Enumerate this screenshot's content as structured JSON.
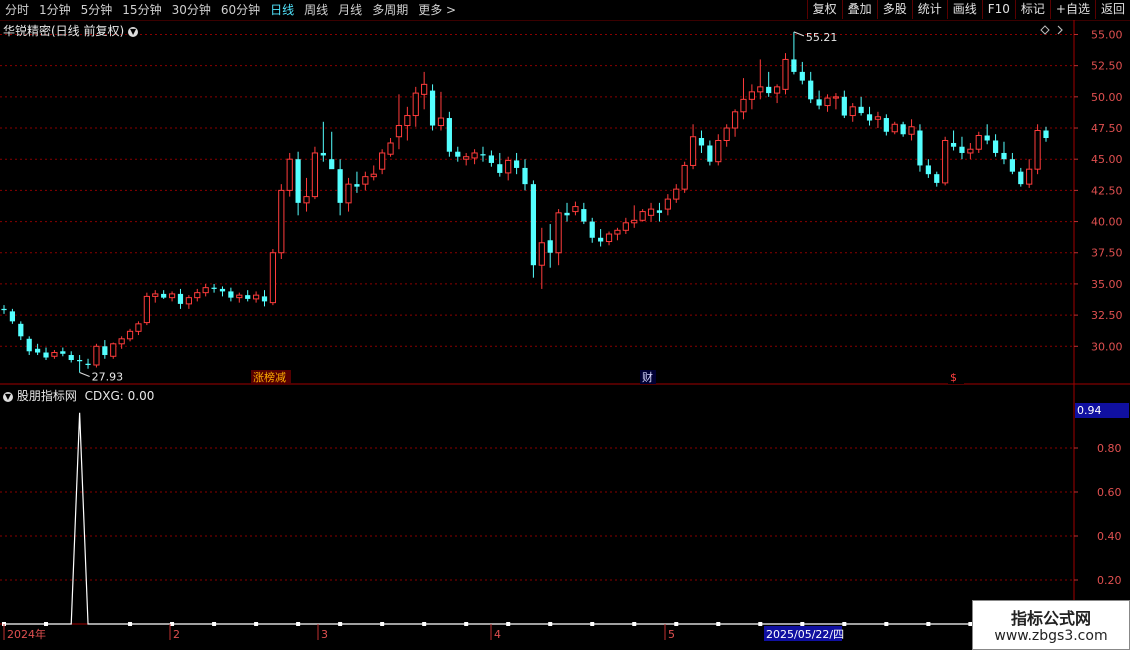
{
  "toolbar": {
    "periods": [
      "分时",
      "1分钟",
      "5分钟",
      "15分钟",
      "30分钟",
      "60分钟",
      "日线",
      "周线",
      "月线",
      "多周期",
      "更多 >"
    ],
    "active_period": "日线",
    "buttons": [
      "复权",
      "叠加",
      "多股",
      "统计",
      "画线",
      "F10",
      "标记",
      "+自选",
      "返回"
    ]
  },
  "main_panel": {
    "title": "华锐精密(日线 前复权)",
    "high_label": "55.21",
    "low_label": "27.93",
    "markers": [
      "涨榜减",
      "财",
      "$"
    ],
    "price_axis": [
      "55.00",
      "52.50",
      "50.00",
      "47.50",
      "45.00",
      "42.50",
      "40.00",
      "37.50",
      "35.00",
      "32.50",
      "30.00"
    ]
  },
  "indicator_panel": {
    "title": "股朋指标网",
    "value_label": "CDXG: 0.00",
    "current_value": "0.94",
    "axis": [
      "0.80",
      "0.60",
      "0.40",
      "0.20"
    ]
  },
  "date_axis": {
    "labels": [
      "2024年",
      "2",
      "3",
      "4",
      "5"
    ],
    "highlighted_date": "2025/05/22/四"
  },
  "watermark": {
    "line1": "指标公式网",
    "line2": "www.zbgs3.com"
  },
  "colors": {
    "up": "#ff3c3c",
    "down": "#54ffff",
    "grid": "#8a0000",
    "active": "#52e6ff",
    "axis_text": "#e05050"
  },
  "chart_data": {
    "type": "candlestick",
    "title": "华锐精密(日线 前复权)",
    "ylim": [
      28.5,
      56.0
    ],
    "ohlc_approx": [
      [
        33.0,
        33.3,
        32.6,
        32.9
      ],
      [
        32.8,
        33.0,
        31.8,
        32.0
      ],
      [
        31.8,
        32.0,
        30.5,
        30.8
      ],
      [
        30.6,
        30.8,
        29.3,
        29.6
      ],
      [
        29.8,
        30.2,
        29.3,
        29.5
      ],
      [
        29.5,
        29.9,
        28.9,
        29.1
      ],
      [
        29.2,
        29.7,
        29.0,
        29.5
      ],
      [
        29.6,
        29.9,
        29.2,
        29.4
      ],
      [
        29.3,
        29.6,
        28.7,
        28.9
      ],
      [
        28.9,
        29.3,
        27.9,
        28.8
      ],
      [
        28.6,
        29.0,
        28.2,
        28.5
      ],
      [
        28.5,
        30.2,
        28.3,
        30.0
      ],
      [
        30.0,
        30.5,
        29.0,
        29.3
      ],
      [
        29.2,
        30.3,
        29.0,
        30.2
      ],
      [
        30.2,
        30.8,
        29.8,
        30.6
      ],
      [
        30.6,
        31.4,
        30.4,
        31.2
      ],
      [
        31.2,
        32.0,
        30.9,
        31.8
      ],
      [
        31.9,
        34.3,
        31.7,
        34.0
      ],
      [
        34.0,
        34.5,
        33.5,
        34.2
      ],
      [
        34.2,
        34.5,
        33.8,
        33.9
      ],
      [
        33.9,
        34.4,
        33.6,
        34.2
      ],
      [
        34.2,
        34.6,
        33.0,
        33.4
      ],
      [
        33.4,
        34.1,
        33.0,
        33.9
      ],
      [
        33.9,
        34.6,
        33.6,
        34.3
      ],
      [
        34.3,
        35.0,
        34.0,
        34.7
      ],
      [
        34.7,
        35.0,
        34.3,
        34.6
      ],
      [
        34.6,
        34.8,
        34.0,
        34.4
      ],
      [
        34.4,
        34.7,
        33.6,
        33.9
      ],
      [
        33.9,
        34.3,
        33.5,
        34.1
      ],
      [
        34.1,
        34.5,
        33.6,
        33.8
      ],
      [
        33.8,
        34.4,
        33.5,
        34.1
      ],
      [
        34.0,
        34.5,
        33.2,
        33.6
      ],
      [
        33.5,
        37.8,
        33.3,
        37.5
      ],
      [
        37.5,
        43.0,
        37.0,
        42.5
      ],
      [
        42.5,
        45.5,
        42.0,
        45.0
      ],
      [
        45.0,
        45.6,
        40.5,
        41.5
      ],
      [
        41.5,
        43.5,
        40.8,
        42.0
      ],
      [
        42.0,
        46.0,
        41.8,
        45.5
      ],
      [
        45.5,
        48.0,
        44.8,
        45.3
      ],
      [
        45.0,
        47.2,
        44.5,
        44.2
      ],
      [
        44.2,
        45.0,
        40.5,
        41.5
      ],
      [
        41.5,
        43.5,
        40.8,
        43.0
      ],
      [
        43.0,
        44.0,
        42.3,
        42.8
      ],
      [
        43.0,
        44.0,
        42.5,
        43.6
      ],
      [
        43.6,
        44.5,
        43.3,
        43.8
      ],
      [
        44.2,
        45.8,
        43.8,
        45.5
      ],
      [
        45.4,
        46.7,
        45.2,
        46.3
      ],
      [
        46.8,
        50.2,
        45.8,
        47.7
      ],
      [
        47.7,
        49.2,
        46.5,
        48.5
      ],
      [
        48.5,
        50.8,
        47.6,
        50.3
      ],
      [
        50.2,
        52.0,
        49.0,
        51.0
      ],
      [
        50.5,
        51.0,
        47.3,
        47.7
      ],
      [
        47.7,
        50.4,
        47.3,
        48.3
      ],
      [
        48.3,
        48.8,
        45.2,
        45.6
      ],
      [
        45.6,
        46.0,
        44.8,
        45.2
      ],
      [
        45.0,
        45.5,
        44.5,
        45.2
      ],
      [
        45.1,
        45.8,
        44.6,
        45.5
      ],
      [
        45.4,
        46.0,
        44.8,
        45.3
      ],
      [
        45.3,
        45.7,
        44.4,
        44.7
      ],
      [
        44.6,
        45.5,
        43.6,
        43.9
      ],
      [
        43.9,
        45.2,
        43.3,
        44.9
      ],
      [
        44.9,
        45.5,
        43.8,
        44.3
      ],
      [
        44.3,
        45.0,
        42.5,
        43.0
      ],
      [
        43.0,
        43.3,
        35.5,
        36.5
      ],
      [
        36.5,
        39.5,
        34.6,
        38.3
      ],
      [
        38.5,
        39.8,
        36.3,
        37.5
      ],
      [
        37.5,
        41.0,
        36.5,
        40.7
      ],
      [
        40.7,
        41.5,
        40.0,
        40.5
      ],
      [
        40.8,
        41.6,
        40.5,
        41.2
      ],
      [
        41.0,
        41.5,
        39.8,
        40.0
      ],
      [
        40.0,
        40.3,
        38.3,
        38.7
      ],
      [
        38.7,
        39.4,
        38.0,
        38.4
      ],
      [
        38.4,
        39.2,
        38.1,
        39.0
      ],
      [
        39.0,
        39.5,
        38.5,
        39.3
      ],
      [
        39.3,
        40.3,
        39.0,
        39.9
      ],
      [
        39.9,
        41.3,
        39.5,
        40.1
      ],
      [
        40.1,
        41.0,
        40.0,
        40.8
      ],
      [
        40.5,
        41.5,
        40.0,
        41.0
      ],
      [
        40.9,
        41.5,
        40.0,
        40.7
      ],
      [
        41.0,
        42.2,
        40.5,
        41.8
      ],
      [
        41.8,
        43.0,
        41.5,
        42.6
      ],
      [
        42.6,
        44.8,
        42.3,
        44.5
      ],
      [
        44.5,
        47.8,
        44.2,
        46.8
      ],
      [
        46.7,
        47.3,
        45.5,
        46.1
      ],
      [
        46.1,
        46.5,
        44.5,
        44.8
      ],
      [
        44.8,
        47.0,
        44.5,
        46.5
      ],
      [
        46.5,
        47.8,
        46.0,
        47.5
      ],
      [
        47.5,
        49.0,
        46.8,
        48.8
      ],
      [
        48.8,
        51.5,
        48.2,
        49.8
      ],
      [
        49.8,
        51.0,
        49.0,
        50.4
      ],
      [
        50.4,
        53.0,
        49.8,
        50.8
      ],
      [
        50.8,
        52.0,
        50.0,
        50.3
      ],
      [
        50.3,
        51.0,
        49.5,
        50.8
      ],
      [
        50.6,
        53.5,
        50.2,
        53.0
      ],
      [
        53.0,
        55.21,
        51.8,
        52.0
      ],
      [
        52.0,
        52.8,
        51.0,
        51.3
      ],
      [
        51.3,
        52.0,
        49.5,
        49.8
      ],
      [
        49.8,
        50.5,
        49.0,
        49.3
      ],
      [
        49.3,
        50.2,
        48.8,
        49.9
      ],
      [
        49.9,
        50.3,
        49.0,
        50.0
      ],
      [
        50.0,
        50.5,
        48.3,
        48.5
      ],
      [
        48.5,
        49.5,
        48.0,
        49.2
      ],
      [
        49.2,
        50.0,
        48.5,
        48.7
      ],
      [
        48.6,
        49.2,
        47.7,
        48.1
      ],
      [
        48.2,
        48.8,
        47.5,
        48.4
      ],
      [
        48.3,
        48.6,
        46.9,
        47.2
      ],
      [
        47.2,
        48.0,
        47.0,
        47.8
      ],
      [
        47.8,
        48.0,
        46.8,
        47.0
      ],
      [
        47.0,
        48.2,
        46.5,
        47.6
      ],
      [
        47.3,
        47.8,
        44.0,
        44.5
      ],
      [
        44.5,
        45.0,
        43.5,
        43.8
      ],
      [
        43.8,
        44.0,
        42.8,
        43.1
      ],
      [
        43.1,
        46.8,
        42.9,
        46.5
      ],
      [
        46.3,
        47.3,
        45.7,
        46.0
      ],
      [
        46.0,
        46.8,
        45.0,
        45.5
      ],
      [
        45.5,
        46.3,
        45.0,
        45.8
      ],
      [
        45.8,
        47.2,
        45.5,
        46.9
      ],
      [
        46.9,
        47.8,
        46.2,
        46.5
      ],
      [
        46.5,
        47.0,
        45.2,
        45.5
      ],
      [
        45.5,
        46.4,
        44.6,
        45.0
      ],
      [
        45.0,
        45.5,
        43.8,
        44.0
      ],
      [
        44.0,
        44.3,
        42.8,
        43.0
      ],
      [
        43.0,
        45.0,
        42.7,
        44.2
      ],
      [
        44.2,
        47.8,
        43.8,
        47.3
      ],
      [
        47.3,
        47.6,
        46.4,
        46.7
      ]
    ]
  }
}
